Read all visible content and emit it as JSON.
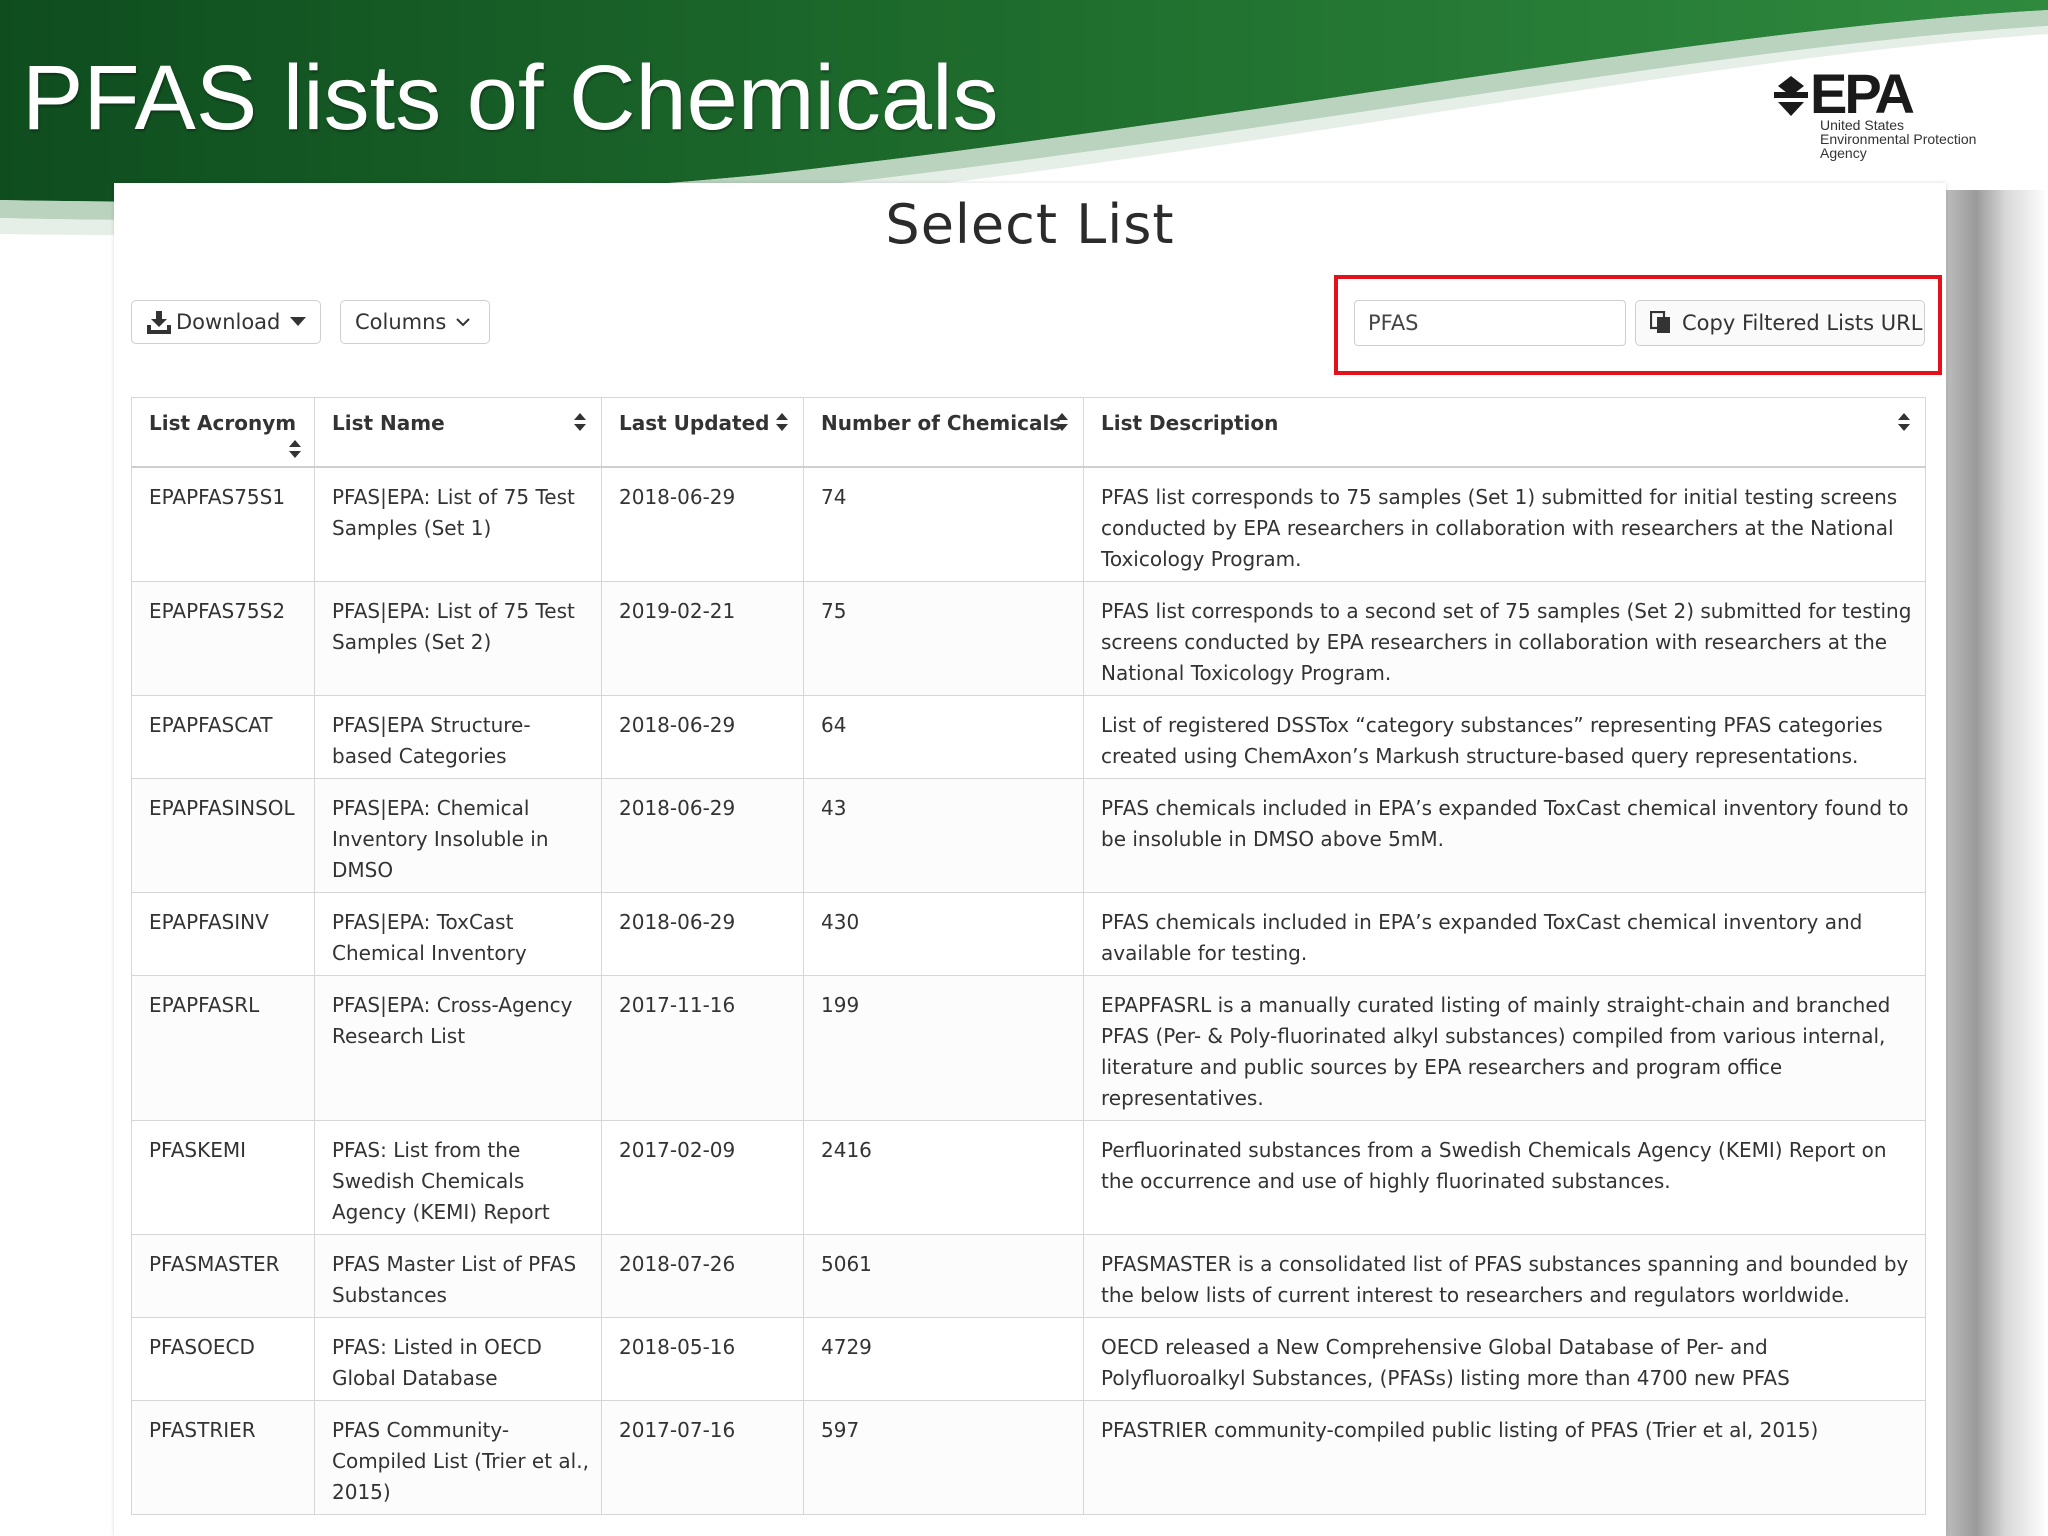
{
  "slide": {
    "title": "PFAS lists of Chemicals",
    "logo": {
      "wordmark": "EPA",
      "line1": "United States",
      "line2": "Environmental Protection",
      "line3": "Agency"
    }
  },
  "panel": {
    "heading": "Select List",
    "toolbar": {
      "download_label": "Download",
      "columns_label": "Columns",
      "search_value": "PFAS",
      "copy_label": "Copy Filtered Lists URL"
    },
    "table": {
      "headers": [
        "List Acronym",
        "List Name",
        "Last Updated",
        "Number of Chemicals",
        "List Description"
      ],
      "rows": [
        {
          "acronym": "EPAPFAS75S1",
          "name": "PFAS|EPA: List of 75 Test Samples (Set 1)",
          "updated": "2018-06-29",
          "count": "74",
          "description": "PFAS list corresponds to 75 samples (Set 1) submitted for initial testing screens conducted by EPA researchers in collaboration with researchers at the National Toxicology Program."
        },
        {
          "acronym": "EPAPFAS75S2",
          "name": "PFAS|EPA: List of 75 Test Samples (Set 2)",
          "updated": "2019-02-21",
          "count": "75",
          "description": "PFAS list corresponds to a second set of 75 samples (Set 2) submitted for testing screens conducted by EPA researchers in collaboration with researchers at the National Toxicology Program."
        },
        {
          "acronym": "EPAPFASCAT",
          "name": "PFAS|EPA Structure-based Categories",
          "updated": "2018-06-29",
          "count": "64",
          "description": "List of registered DSSTox “category substances” representing PFAS categories created using ChemAxon’s Markush structure-based query representations."
        },
        {
          "acronym": "EPAPFASINSOL",
          "name": "PFAS|EPA: Chemical Inventory Insoluble in DMSO",
          "updated": "2018-06-29",
          "count": "43",
          "description": "PFAS chemicals included in EPA’s expanded ToxCast chemical inventory found to be insoluble in DMSO above 5mM."
        },
        {
          "acronym": "EPAPFASINV",
          "name": "PFAS|EPA: ToxCast Chemical Inventory",
          "updated": "2018-06-29",
          "count": "430",
          "description": "PFAS chemicals included in EPA’s expanded ToxCast chemical inventory and available for testing."
        },
        {
          "acronym": "EPAPFASRL",
          "name": "PFAS|EPA: Cross-Agency Research List",
          "updated": "2017-11-16",
          "count": "199",
          "description": "EPAPFASRL is a manually curated listing of mainly straight-chain and branched PFAS (Per- & Poly-fluorinated alkyl substances) compiled from various internal, literature and public sources by EPA researchers and program office representatives."
        },
        {
          "acronym": "PFASKEMI",
          "name": "PFAS: List from the Swedish Chemicals Agency (KEMI) Report",
          "updated": "2017-02-09",
          "count": "2416",
          "description": "Perfluorinated substances from a Swedish Chemicals Agency (KEMI) Report on the occurrence and use of highly fluorinated substances."
        },
        {
          "acronym": "PFASMASTER",
          "name": "PFAS Master List of PFAS Substances",
          "updated": "2018-07-26",
          "count": "5061",
          "description": "PFASMASTER is a consolidated list of PFAS substances spanning and bounded by the below lists of current interest to researchers and regulators worldwide."
        },
        {
          "acronym": "PFASOECD",
          "name": "PFAS: Listed in OECD Global Database",
          "updated": "2018-05-16",
          "count": "4729",
          "description": "OECD released a New Comprehensive Global Database of Per- and Polyfluoroalkyl Substances, (PFASs) listing more than 4700 new PFAS"
        },
        {
          "acronym": "PFASTRIER",
          "name": "PFAS Community-Compiled List (Trier et al., 2015)",
          "updated": "2017-07-16",
          "count": "597",
          "description": "PFASTRIER community-compiled public listing of PFAS (Trier et al, 2015)"
        }
      ]
    }
  },
  "colors": {
    "banner_green": "#1f6b2e",
    "link_blue": "#2a6bb0",
    "highlight_red": "#e3111b"
  },
  "icons": [
    "download-icon",
    "caret-down-icon",
    "chevron-down-icon",
    "copy-icon",
    "sort-icon"
  ]
}
